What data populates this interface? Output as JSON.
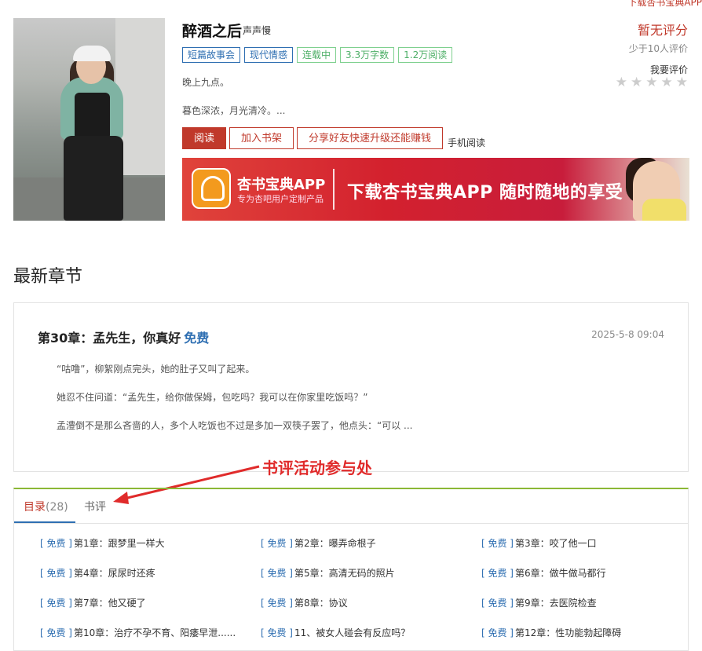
{
  "top_link": "下载杏书宝典APP",
  "book": {
    "title": "醉酒之后",
    "author": "声声慢",
    "tags": [
      {
        "label": "短篇故事会",
        "style": "blue"
      },
      {
        "label": "现代情感",
        "style": "blue"
      },
      {
        "label": "连载中",
        "style": "green"
      },
      {
        "label": "3.3万字数",
        "style": "green"
      },
      {
        "label": "1.2万阅读",
        "style": "green"
      }
    ],
    "intro_line1": "晚上九点。",
    "intro_line2": "暮色深浓，月光清冷。...",
    "buttons": {
      "read": "阅读",
      "add_shelf": "加入书架",
      "share": "分享好友快速升级还能赚钱",
      "mobile": "手机阅读"
    }
  },
  "rating": {
    "title": "暂无评分",
    "count": "少于10人评价",
    "rate_link": "我要评价",
    "stars": 5
  },
  "banner": {
    "app_name": "杏书宝典APP",
    "app_sub": "专为杏吧用户定制产品",
    "slogan": "下载杏书宝典APP 随时随地的享受"
  },
  "latest": {
    "section_title": "最新章节",
    "chapter_title": "第30章：孟先生，你真好",
    "chapter_free": "免费",
    "date": "2025-5-8 09:04",
    "paragraphs": [
      "“咕噜”，柳絮刚点完头，她的肚子又叫了起来。",
      "她忍不住问道：“孟先生，给你做保姆，包吃吗？我可以在你家里吃饭吗？”",
      "孟澧倒不是那么吝啬的人，多个人吃饭也不过是多加一双筷子罢了，他点头：“可以 ..."
    ]
  },
  "annotation": "书评活动参与处",
  "toc": {
    "tab_catalog": "目录",
    "tab_catalog_count": "(28)",
    "tab_review": "书评",
    "free_label": "[ 免费 ]",
    "chapters": [
      "第1章：跟梦里一样大",
      "第2章：曝弄命根子",
      "第3章：咬了他一口",
      "第4章：尿尿时还疼",
      "第5章：高清无码的照片",
      "第6章：做牛做马都行",
      "第7章：他又硬了",
      "第8章：协议",
      "第9章：去医院检查",
      "第10章：治疗不孕不育、阳痿早泄......",
      "11、被女人碰会有反应吗？",
      "第12章：性功能勃起障碍"
    ]
  }
}
